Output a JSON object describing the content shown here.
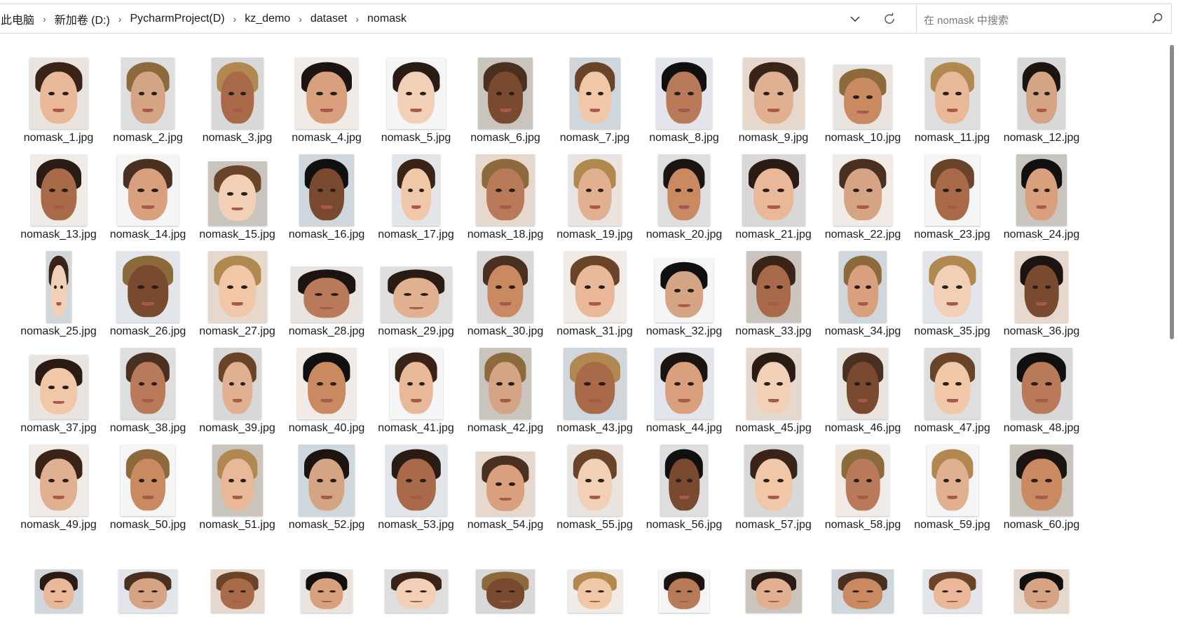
{
  "address_bar": {
    "crumbs": [
      "此电脑",
      "新加卷 (D:)",
      "PycharmProject(D)",
      "kz_demo",
      "dataset",
      "nomask"
    ],
    "separator": "›",
    "dropdown_icon": "chevron-down-icon",
    "refresh_icon": "refresh-icon"
  },
  "search": {
    "placeholder": "在 nomask 中搜索",
    "icon": "search-icon"
  },
  "files": [
    "nomask_1.jpg",
    "nomask_2.jpg",
    "nomask_3.jpg",
    "nomask_4.jpg",
    "nomask_5.jpg",
    "nomask_6.jpg",
    "nomask_7.jpg",
    "nomask_8.jpg",
    "nomask_9.jpg",
    "nomask_10.jpg",
    "nomask_11.jpg",
    "nomask_12.jpg",
    "nomask_13.jpg",
    "nomask_14.jpg",
    "nomask_15.jpg",
    "nomask_16.jpg",
    "nomask_17.jpg",
    "nomask_18.jpg",
    "nomask_19.jpg",
    "nomask_20.jpg",
    "nomask_21.jpg",
    "nomask_22.jpg",
    "nomask_23.jpg",
    "nomask_24.jpg",
    "nomask_25.jpg",
    "nomask_26.jpg",
    "nomask_27.jpg",
    "nomask_28.jpg",
    "nomask_29.jpg",
    "nomask_30.jpg",
    "nomask_31.jpg",
    "nomask_32.jpg",
    "nomask_33.jpg",
    "nomask_34.jpg",
    "nomask_35.jpg",
    "nomask_36.jpg",
    "nomask_37.jpg",
    "nomask_38.jpg",
    "nomask_39.jpg",
    "nomask_40.jpg",
    "nomask_41.jpg",
    "nomask_42.jpg",
    "nomask_43.jpg",
    "nomask_44.jpg",
    "nomask_45.jpg",
    "nomask_46.jpg",
    "nomask_47.jpg",
    "nomask_48.jpg",
    "nomask_49.jpg",
    "nomask_50.jpg",
    "nomask_51.jpg",
    "nomask_52.jpg",
    "nomask_53.jpg",
    "nomask_54.jpg",
    "nomask_55.jpg",
    "nomask_56.jpg",
    "nomask_57.jpg",
    "nomask_58.jpg",
    "nomask_59.jpg",
    "nomask_60.jpg",
    "",
    "",
    "",
    "",
    "",
    "",
    "",
    "",
    "",
    "",
    "",
    ""
  ]
}
